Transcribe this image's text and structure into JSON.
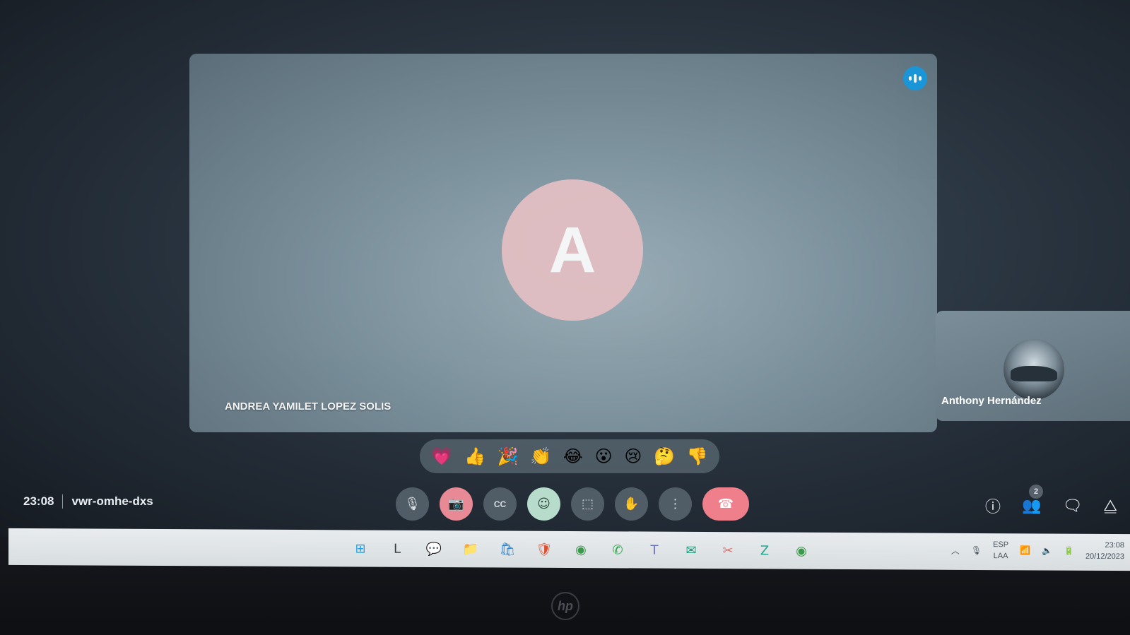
{
  "main_participant": {
    "initial": "A",
    "name": "ANDREA YAMILET LOPEZ SOLIS",
    "avatar_color": "#e7c4c8"
  },
  "side_participant": {
    "name": "Anthony Hernández"
  },
  "reactions": [
    "💗",
    "👍",
    "🎉",
    "👏",
    "😂",
    "😮",
    "😢",
    "🤔",
    "👎"
  ],
  "meeting": {
    "time": "23:08",
    "code": "vwr-omhe-dxs"
  },
  "controls": [
    {
      "name": "microphone-button",
      "icon": "🎙"
    },
    {
      "name": "camera-off-button",
      "icon": "📷"
    },
    {
      "name": "captions-button",
      "icon": "CC"
    },
    {
      "name": "reactions-button",
      "icon": "☺"
    },
    {
      "name": "present-screen-button",
      "icon": "⬚"
    },
    {
      "name": "raise-hand-button",
      "icon": "✋"
    },
    {
      "name": "more-options-button",
      "icon": "⋮"
    },
    {
      "name": "leave-call-button",
      "icon": "☎"
    }
  ],
  "right_panel": {
    "participants_count": "2"
  },
  "taskbar": {
    "apps": [
      {
        "name": "windows-start-icon",
        "icon": "⊞",
        "color": "#1fa3e0"
      },
      {
        "name": "search-icon",
        "icon": "L",
        "color": "#3a3f44"
      },
      {
        "name": "chat-icon",
        "icon": "💬",
        "color": "#7a8a96"
      },
      {
        "name": "file-explorer-icon",
        "icon": "📁",
        "color": "#e6b84a"
      },
      {
        "name": "store-icon",
        "icon": "🛍",
        "color": "#2a7fc8"
      },
      {
        "name": "brave-icon",
        "icon": "🛡",
        "color": "#e24d2f"
      },
      {
        "name": "chrome-icon",
        "icon": "◉",
        "color": "#3a9a4a"
      },
      {
        "name": "whatsapp-icon",
        "icon": "✆",
        "color": "#25a244"
      },
      {
        "name": "teams-icon",
        "icon": "T",
        "color": "#6a72c0"
      },
      {
        "name": "mail-icon",
        "icon": "✉",
        "color": "#1c9a7a"
      },
      {
        "name": "tool-icon",
        "icon": "✂",
        "color": "#e07070"
      },
      {
        "name": "z-app-icon",
        "icon": "Z",
        "color": "#1fa58a"
      },
      {
        "name": "chrome-active-icon",
        "icon": "◉",
        "color": "#3a9a4a"
      }
    ],
    "lang_top": "ESP",
    "lang_bottom": "LAA",
    "clock_time": "23:08",
    "clock_date": "20/12/2023"
  },
  "brand": "hp"
}
